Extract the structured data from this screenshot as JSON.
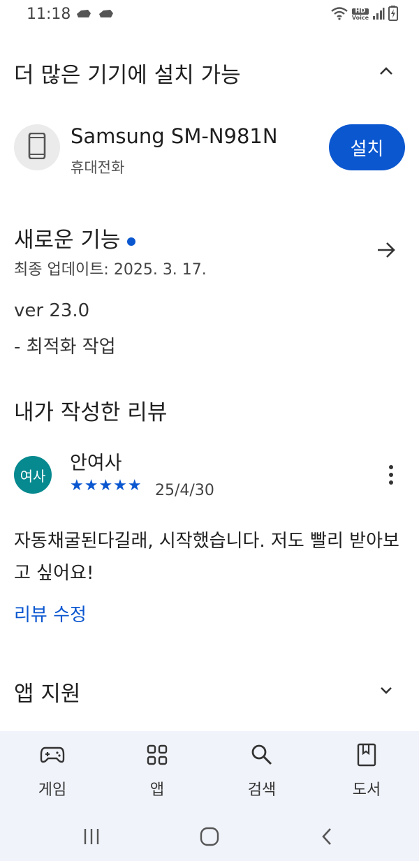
{
  "status_bar": {
    "time": "11:18",
    "notification_icons": [
      "cloud-icon",
      "cloud-icon"
    ],
    "right_icons": [
      "wifi-icon",
      "hd-voice-icon",
      "signal-icon",
      "battery-charging-icon"
    ],
    "hd_top": "HD",
    "hd_bottom": "Voice"
  },
  "devices_section": {
    "title": "더 많은 기기에 설치 가능",
    "device_name": "Samsung SM-N981N",
    "device_type": "휴대전화",
    "install_label": "설치"
  },
  "whats_new": {
    "title": "새로운 기능",
    "updated": "최종 업데이트: 2025. 3. 17.",
    "version": "ver 23.0",
    "note": "- 최적화 작업"
  },
  "my_review": {
    "heading": "내가 작성한 리뷰",
    "avatar_text": "여사",
    "reviewer": "안여사",
    "stars": "★★★★★",
    "rating": 5,
    "date": "25/4/30",
    "text": "자동채굴된다길래, 시작했습니다. 저도 빨리 받아보고 싶어요!",
    "edit_label": "리뷰 수정"
  },
  "app_support": {
    "title": "앱 지원"
  },
  "bottom_nav": {
    "items": [
      {
        "label": "게임",
        "icon": "gamepad-icon"
      },
      {
        "label": "앱",
        "icon": "apps-grid-icon"
      },
      {
        "label": "검색",
        "icon": "search-icon"
      },
      {
        "label": "도서",
        "icon": "book-icon"
      }
    ]
  },
  "colors": {
    "accent": "#0b57d0",
    "avatar": "#06898f",
    "nav_background": "#f0f3f9"
  }
}
